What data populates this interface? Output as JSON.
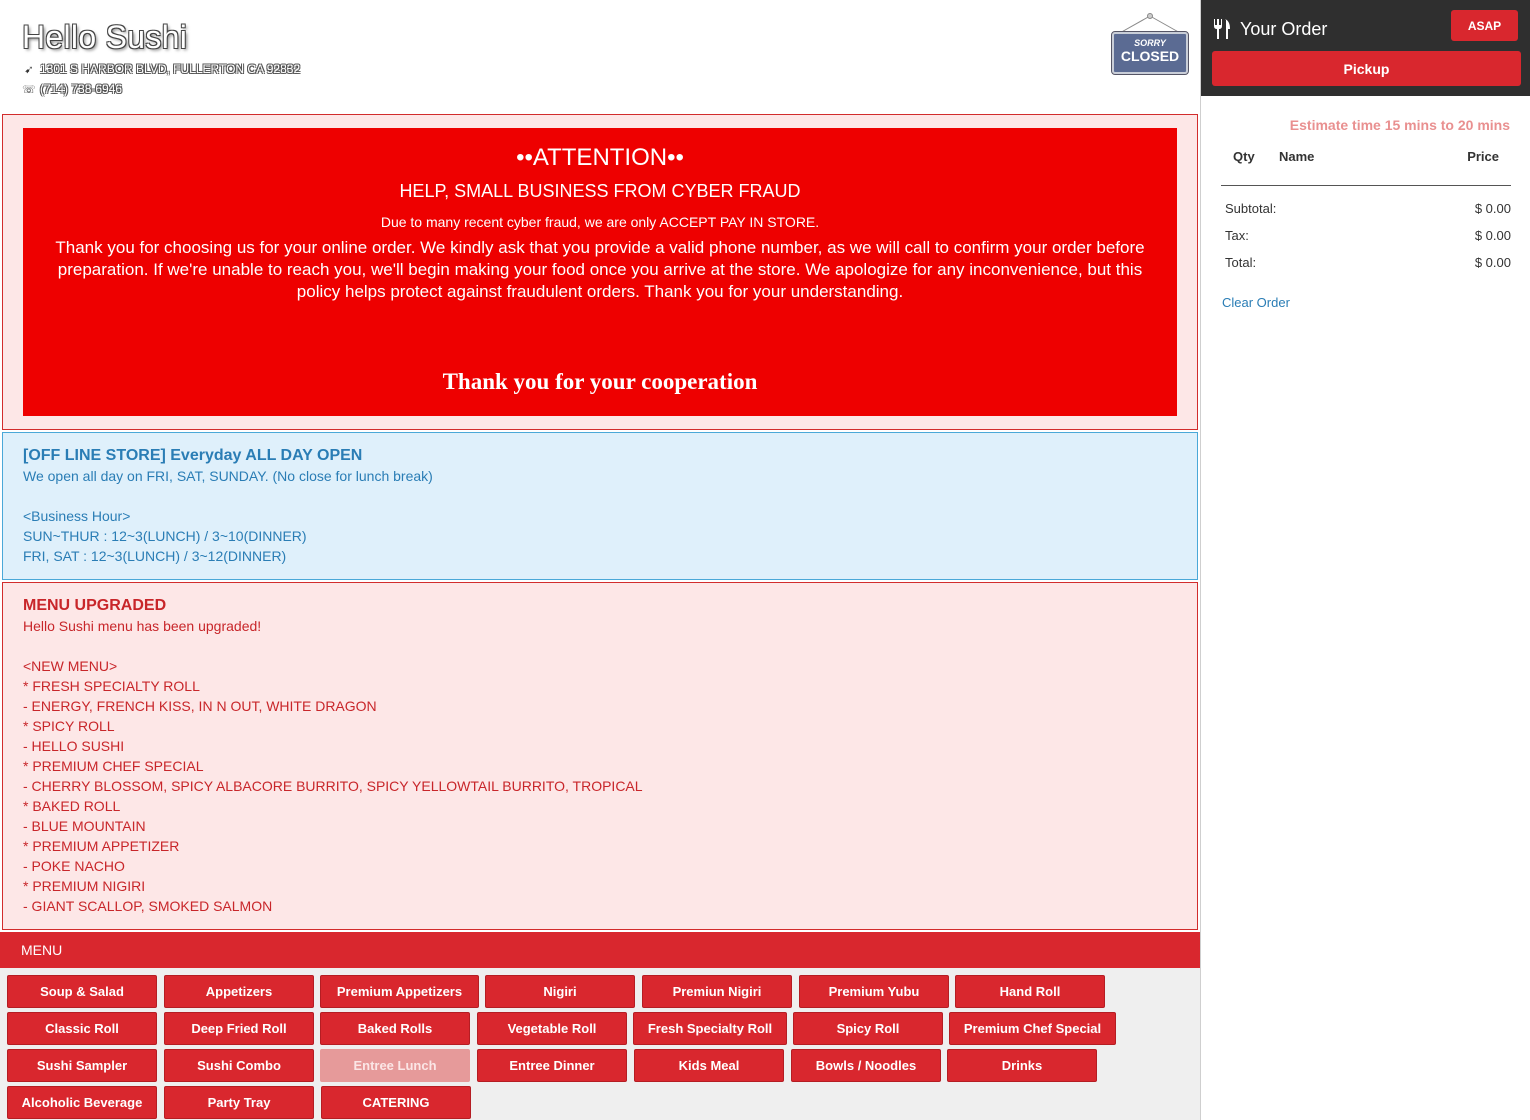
{
  "store": {
    "name": "Hello Sushi",
    "address": "1301 S HARBOR BLVD, FULLERTON CA 92832",
    "phone": "(714) 738-6946",
    "sign": {
      "sorry": "SORRY",
      "closed": "CLOSED"
    }
  },
  "attention": {
    "title": "••ATTENTION••",
    "subtitle": "HELP, SMALL BUSINESS FROM CYBER FRAUD",
    "note": "Due to many recent cyber fraud, we are only ACCEPT PAY IN STORE.",
    "body": "Thank you for choosing us for your online order. We kindly ask that you provide a valid phone number, as we will call to confirm your order before preparation. If we're unable to reach you, we'll begin making your food once you arrive at the store. We apologize for any inconvenience, but this policy helps protect against fraudulent orders. Thank you for your understanding.",
    "thanks": "Thank you for your cooperation"
  },
  "hours": {
    "title": "[OFF LINE STORE] Everyday ALL DAY OPEN",
    "lines": [
      "We open all day on FRI, SAT, SUNDAY. (No close for lunch break)",
      "",
      "<Business Hour>",
      "SUN~THUR : 12~3(LUNCH) / 3~10(DINNER)",
      "FRI, SAT : 12~3(LUNCH) / 3~12(DINNER)"
    ]
  },
  "menu_upgraded": {
    "title": "MENU UPGRADED",
    "lines": [
      "Hello Sushi menu has been upgraded!",
      "",
      "<NEW MENU>",
      "* FRESH SPECIALTY ROLL",
      "- ENERGY, FRENCH KISS, IN N OUT, WHITE DRAGON",
      "* SPICY ROLL",
      "- HELLO SUSHI",
      "* PREMIUM CHEF SPECIAL",
      "- CHERRY BLOSSOM, SPICY ALBACORE BURRITO, SPICY YELLOWTAIL BURRITO, TROPICAL",
      "* BAKED ROLL",
      "- BLUE MOUNTAIN",
      "* PREMIUM APPETIZER",
      "- POKE NACHO",
      "* PREMIUM NIGIRI",
      "- GIANT SCALLOP, SMOKED SALMON"
    ]
  },
  "menu": {
    "label": "MENU",
    "categories": [
      {
        "label": "Soup & Salad"
      },
      {
        "label": "Appetizers"
      },
      {
        "label": "Premium Appetizers"
      },
      {
        "label": "Nigiri"
      },
      {
        "label": "Premiun Nigiri"
      },
      {
        "label": "Premium Yubu"
      },
      {
        "label": "Hand Roll"
      },
      {
        "label": "Classic Roll"
      },
      {
        "label": "Deep Fried Roll"
      },
      {
        "label": "Baked Rolls"
      },
      {
        "label": "Vegetable Roll"
      },
      {
        "label": "Fresh Specialty Roll"
      },
      {
        "label": "Spicy Roll"
      },
      {
        "label": "Premium Chef Special"
      },
      {
        "label": "Sushi Sampler"
      },
      {
        "label": "Sushi Combo"
      },
      {
        "label": "Entree Lunch",
        "state": "disabled"
      },
      {
        "label": "Entree Dinner"
      },
      {
        "label": "Kids Meal"
      },
      {
        "label": "Bowls / Noodles"
      },
      {
        "label": "Drinks"
      },
      {
        "label": "Alcoholic Beverage"
      },
      {
        "label": "Party Tray"
      },
      {
        "label": "CATERING"
      }
    ]
  },
  "order": {
    "title": "Your Order",
    "time_button": "ASAP",
    "mode_button": "Pickup",
    "estimate": "Estimate time 15 mins to 20 mins",
    "columns": {
      "qty": "Qty",
      "name": "Name",
      "price": "Price"
    },
    "summary": [
      {
        "label": "Subtotal:",
        "value": "$ 0.00"
      },
      {
        "label": "Tax:",
        "value": "$ 0.00"
      },
      {
        "label": "Total:",
        "value": "$ 0.00"
      }
    ],
    "clear": "Clear Order"
  },
  "colors": {
    "brand_red": "#d9272e",
    "attention_red": "#ee0000",
    "info_blue": "#2a7db5",
    "dark_header": "#2f2f2f"
  },
  "icons": [
    "location-arrow-icon",
    "phone-icon",
    "fork-knife-icon"
  ]
}
